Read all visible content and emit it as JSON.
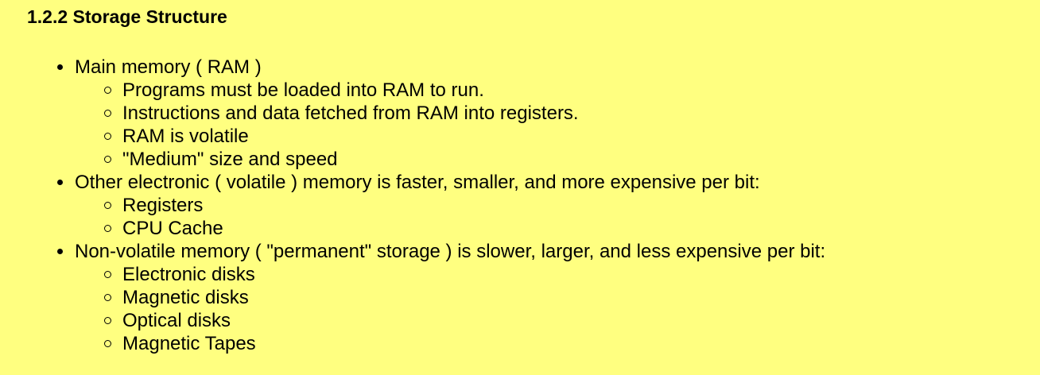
{
  "heading": "1.2.2 Storage Structure",
  "items": [
    {
      "text": "Main memory ( RAM )",
      "subitems": [
        "Programs must be loaded into RAM to run.",
        "Instructions and data fetched from RAM into registers.",
        "RAM is volatile",
        "\"Medium\" size and speed"
      ]
    },
    {
      "text": "Other electronic ( volatile ) memory is faster, smaller, and more expensive per bit:",
      "subitems": [
        "Registers",
        "CPU Cache"
      ]
    },
    {
      "text": "Non-volatile memory ( \"permanent\" storage ) is slower, larger, and less expensive per bit:",
      "subitems": [
        "Electronic disks",
        "Magnetic disks",
        "Optical disks",
        "Magnetic Tapes"
      ]
    }
  ],
  "colors": {
    "background": "#ffff80",
    "text": "#000000"
  }
}
